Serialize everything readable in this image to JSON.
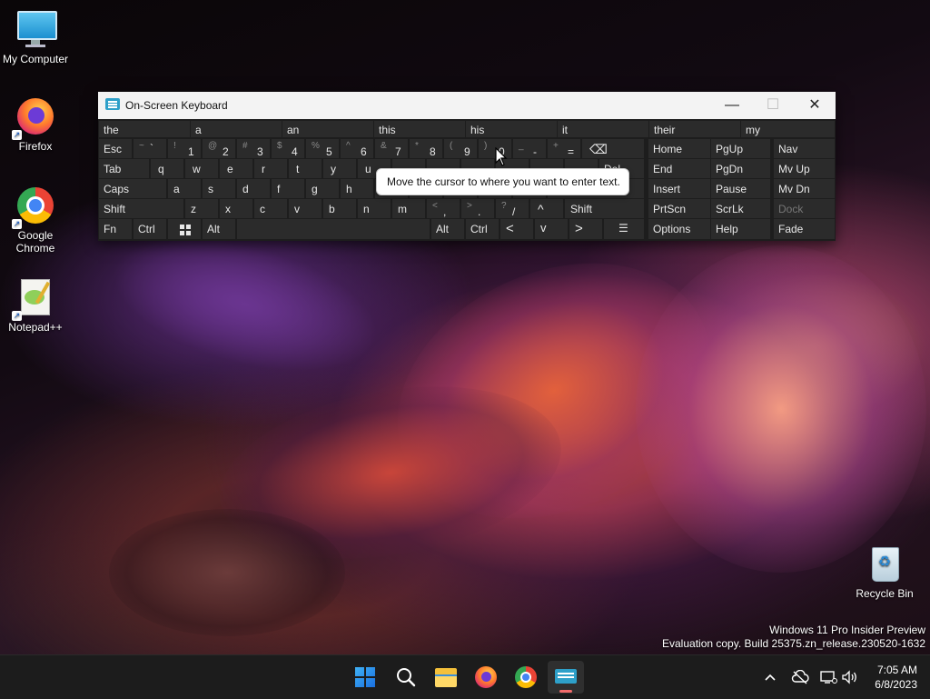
{
  "desktop": {
    "icons": [
      {
        "label": "My Computer"
      },
      {
        "label": "Firefox"
      },
      {
        "label": "Google Chrome"
      },
      {
        "label": "Notepad++"
      },
      {
        "label": "Recycle Bin"
      }
    ],
    "watermark": {
      "line1": "Windows 11 Pro Insider Preview",
      "line2": "Evaluation copy. Build 25375.zn_release.230520-1632"
    }
  },
  "osk": {
    "title": "On-Screen Keyboard",
    "predictions": [
      "the",
      "a",
      "an",
      "this",
      "his",
      "it",
      "their",
      "my"
    ],
    "row1": {
      "esc": "Esc",
      "tilde_s": "~",
      "tilde_m": "`",
      "n1_s": "!",
      "n1": "1",
      "n2_s": "@",
      "n2": "2",
      "n3_s": "#",
      "n3": "3",
      "n4_s": "$",
      "n4": "4",
      "n5_s": "%",
      "n5": "5",
      "n6_s": "^",
      "n6": "6",
      "n7_s": "&",
      "n7": "7",
      "n8_s": "*",
      "n8": "8",
      "n9_s": "(",
      "n9": "9",
      "n0_s": ")",
      "n0": "0",
      "minus_s": "_",
      "minus": "-",
      "eq_s": "+",
      "eq": "=",
      "backspace": "⌫"
    },
    "row2": {
      "tab": "Tab",
      "keys": [
        "q",
        "w",
        "e",
        "r",
        "t",
        "y",
        "u"
      ],
      "del": "Del"
    },
    "row3": {
      "caps": "Caps",
      "keys": [
        "a",
        "s",
        "d",
        "f",
        "g",
        "h"
      ]
    },
    "row4": {
      "shift": "Shift",
      "keys": [
        "z",
        "x",
        "c",
        "v",
        "b",
        "n",
        "m"
      ],
      "comma_s": "<",
      "comma": ",",
      "period_s": ">",
      "period": ".",
      "slash_s": "?",
      "slash": "/",
      "up": "^",
      "rshift": "Shift"
    },
    "row5": {
      "fn": "Fn",
      "ctrl": "Ctrl",
      "alt": "Alt",
      "ralt": "Alt",
      "rctrl": "Ctrl",
      "left": "<",
      "down": "v",
      "right": ">",
      "menu": "☰"
    },
    "nav": [
      [
        "Home",
        "PgUp",
        "Nav"
      ],
      [
        "End",
        "PgDn",
        "Mv Up"
      ],
      [
        "Insert",
        "Pause",
        "Mv Dn"
      ],
      [
        "PrtScn",
        "ScrLk",
        "Dock"
      ],
      [
        "Options",
        "Help",
        "Fade"
      ]
    ],
    "tooltip": "Move the cursor to where you want to enter text."
  },
  "taskbar": {
    "clock": {
      "time": "7:05 AM",
      "date": "6/8/2023"
    }
  }
}
